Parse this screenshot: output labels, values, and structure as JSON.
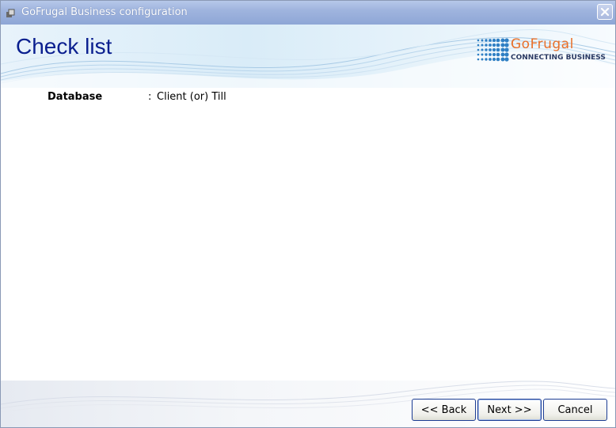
{
  "window": {
    "title": "GoFrugal Business configuration",
    "close_icon": "close-icon"
  },
  "header": {
    "page_title": "Check list"
  },
  "logo": {
    "brand": "GoFrugal",
    "tagline": "CONNECTING BUSINESS",
    "brand_color": "#e8702a",
    "dot_color": "#2f7fc4"
  },
  "checklist": {
    "items": [
      {
        "label": "Database",
        "separator": ":",
        "value": "Client (or) Till"
      }
    ]
  },
  "buttons": {
    "back": "<< Back",
    "next": "Next >>",
    "cancel": "Cancel"
  },
  "colors": {
    "title_blue": "#0a1f8f",
    "titlebar": "#9fb4de",
    "button_border": "#1b3c93"
  }
}
